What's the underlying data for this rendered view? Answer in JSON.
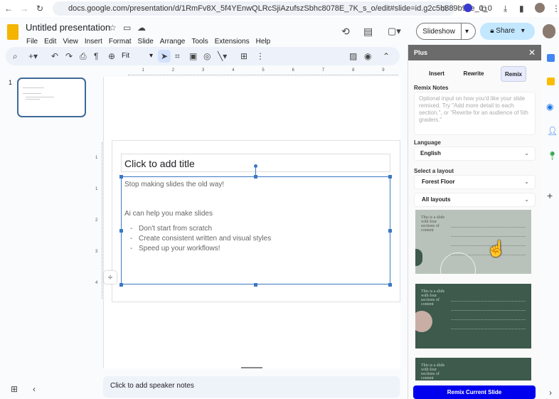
{
  "browser": {
    "url": "docs.google.com/presentation/d/1RmFv8X_5f4YEnwQLRcSjiAzufszSbhc8078E_7K_s_o/edit#slide=id.g2c5b889b9ce_0_0"
  },
  "app": {
    "title": "Untitled presentation",
    "menus": [
      "File",
      "Edit",
      "View",
      "Insert",
      "Format",
      "Slide",
      "Arrange",
      "Tools",
      "Extensions",
      "Help"
    ],
    "slideshow_label": "Slideshow",
    "share_label": "Share",
    "zoom": "Fit"
  },
  "filmstrip": {
    "slide_number": "1"
  },
  "slide": {
    "title_placeholder": "Click to add title",
    "line1": "Stop making slides the old way!",
    "line2": "Ai can help you make slides",
    "bullets": [
      "Don't start from scratch",
      "Create consistent written and visual styles",
      "Speed up your workflows!"
    ],
    "bullet_marker": "-"
  },
  "ruler": {
    "h": [
      "1",
      "2",
      "3",
      "4",
      "5",
      "6",
      "7",
      "8",
      "9"
    ],
    "v": [
      "1",
      "1",
      "2",
      "3",
      "4"
    ]
  },
  "notes": {
    "placeholder": "Click to add speaker notes"
  },
  "plus": {
    "title": "Plus",
    "tabs": [
      "Insert",
      "Rewrite",
      "Remix"
    ],
    "active_tab": "Remix",
    "notes_label": "Remix Notes",
    "notes_placeholder": "Optional input on how you'd like your slide remixed. Try \"Add more detail to each section.\", or \"Rewrite for an audience of 5th graders.\"",
    "language_label": "Language",
    "language": "English",
    "layout_label": "Select a layout",
    "layout_theme": "Forest Floor",
    "layout_filter": "All layouts",
    "thumb_title": "This is a slide with four sections of content",
    "remix_button": "Remix Current Slide"
  },
  "colors": {
    "accent": "#0b57d0",
    "remix": "#0000ee",
    "forest": "#3d5a4c",
    "sage": "#b8c2ba"
  }
}
